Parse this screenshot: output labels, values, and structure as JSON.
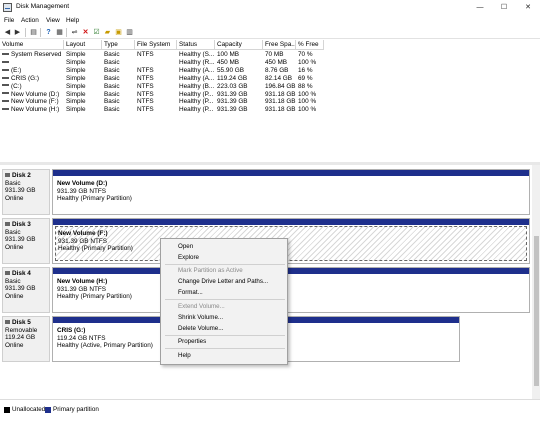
{
  "window": {
    "title": "Disk Management",
    "minimize": "—",
    "maximize": "☐",
    "close": "✕"
  },
  "menu": [
    "File",
    "Action",
    "View",
    "Help"
  ],
  "toolbar": [
    "back-icon",
    "forward-icon",
    "list-view-icon",
    "help-icon",
    "properties-icon",
    "connect-icon",
    "delete-icon",
    "check-icon",
    "new-icon",
    "open-icon",
    "view-icon"
  ],
  "volume_table": {
    "headers": [
      "Volume",
      "Layout",
      "Type",
      "File System",
      "Status",
      "Capacity",
      "Free Spa...",
      "% Free"
    ],
    "rows": [
      [
        "System Reserved",
        "Simple",
        "Basic",
        "NTFS",
        "Healthy (S...",
        "100 MB",
        "70 MB",
        "70 %"
      ],
      [
        "",
        "Simple",
        "Basic",
        "",
        "Healthy (R...",
        "450 MB",
        "450 MB",
        "100 %"
      ],
      [
        "(E:)",
        "Simple",
        "Basic",
        "NTFS",
        "Healthy (A...",
        "55.90 GB",
        "8.76 GB",
        "16 %"
      ],
      [
        "CRIS (G:)",
        "Simple",
        "Basic",
        "NTFS",
        "Healthy (A...",
        "119.24 GB",
        "82.14 GB",
        "69 %"
      ],
      [
        "(C:)",
        "Simple",
        "Basic",
        "NTFS",
        "Healthy (B...",
        "223.03 GB",
        "196.84 GB",
        "88 %"
      ],
      [
        "New Volume (D:)",
        "Simple",
        "Basic",
        "NTFS",
        "Healthy (P...",
        "931.39 GB",
        "931.18 GB",
        "100 %"
      ],
      [
        "New Volume (F:)",
        "Simple",
        "Basic",
        "NTFS",
        "Healthy (P...",
        "931.39 GB",
        "931.18 GB",
        "100 %"
      ],
      [
        "New Volume (H:)",
        "Simple",
        "Basic",
        "NTFS",
        "Healthy (P...",
        "931.39 GB",
        "931.18 GB",
        "100 %"
      ]
    ]
  },
  "disks": [
    {
      "name": "Disk 2",
      "type": "Basic",
      "size": "931.39 GB",
      "state": "Online",
      "partition": {
        "name": "New Volume  (D:)",
        "size": "931.39 GB NTFS",
        "status": "Healthy (Primary Partition)"
      }
    },
    {
      "name": "Disk 3",
      "type": "Basic",
      "size": "931.39 GB",
      "state": "Online",
      "partition": {
        "name": "New Volume  (F:)",
        "size": "931.39 GB NTFS",
        "status": "Healthy (Primary Partition)"
      }
    },
    {
      "name": "Disk 4",
      "type": "Basic",
      "size": "931.39 GB",
      "state": "Online",
      "partition": {
        "name": "New Volume  (H:)",
        "size": "931.39 GB NTFS",
        "status": "Healthy (Primary Partition)"
      }
    },
    {
      "name": "Disk 5",
      "type": "Removable",
      "size": "119.24 GB",
      "state": "Online",
      "partition": {
        "name": "CRIS  (G:)",
        "size": "119.24 GB NTFS",
        "status": "Healthy (Active, Primary Partition)"
      }
    }
  ],
  "context_menu": {
    "open": "Open",
    "explore": "Explore",
    "mark_active": "Mark Partition as Active",
    "change_letter": "Change Drive Letter and Paths...",
    "format": "Format...",
    "extend": "Extend Volume...",
    "shrink": "Shrink Volume...",
    "delete": "Delete Volume...",
    "properties": "Properties",
    "help": "Help"
  },
  "legend": [
    {
      "label": "Unallocated",
      "color": "#000000"
    },
    {
      "label": "Primary partition",
      "color": "#1e2f8c"
    }
  ]
}
